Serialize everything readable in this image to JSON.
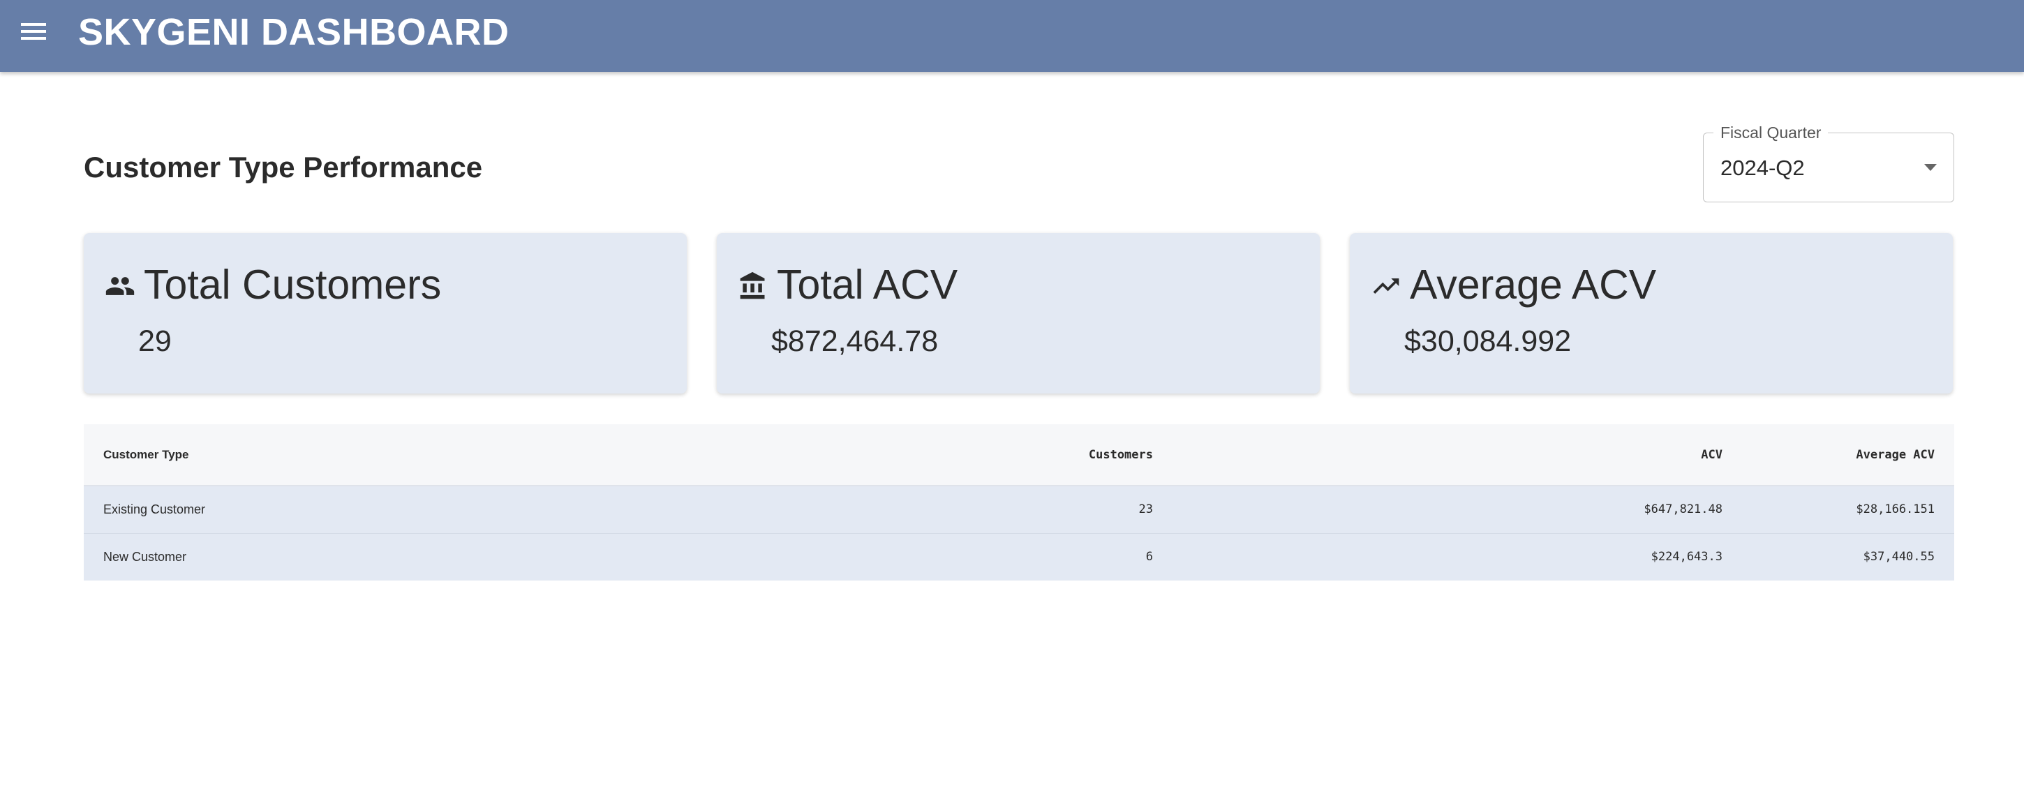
{
  "app": {
    "title": "SKYGENI DASHBOARD"
  },
  "page": {
    "title": "Customer Type Performance"
  },
  "filters": {
    "fiscal_quarter": {
      "label": "Fiscal Quarter",
      "selected": "2024-Q2"
    }
  },
  "kpis": [
    {
      "title": "Total Customers",
      "value": "29",
      "icon": "people-icon"
    },
    {
      "title": "Total ACV",
      "value": "$872,464.78",
      "icon": "bank-icon"
    },
    {
      "title": "Average ACV",
      "value": "$30,084.992",
      "icon": "trending-up-icon"
    }
  ],
  "table": {
    "columns": [
      "Customer Type",
      "Customers",
      "ACV",
      "Average ACV"
    ],
    "rows": [
      [
        "Existing Customer",
        "23",
        "$647,821.48",
        "$28,166.151"
      ],
      [
        "New Customer",
        "6",
        "$224,643.3",
        "$37,440.55"
      ]
    ]
  },
  "colors": {
    "appbar": "#667ea8",
    "card_background": "#e3e9f3",
    "table_header_background": "#f6f7f9",
    "text": "#2b2b2b"
  }
}
